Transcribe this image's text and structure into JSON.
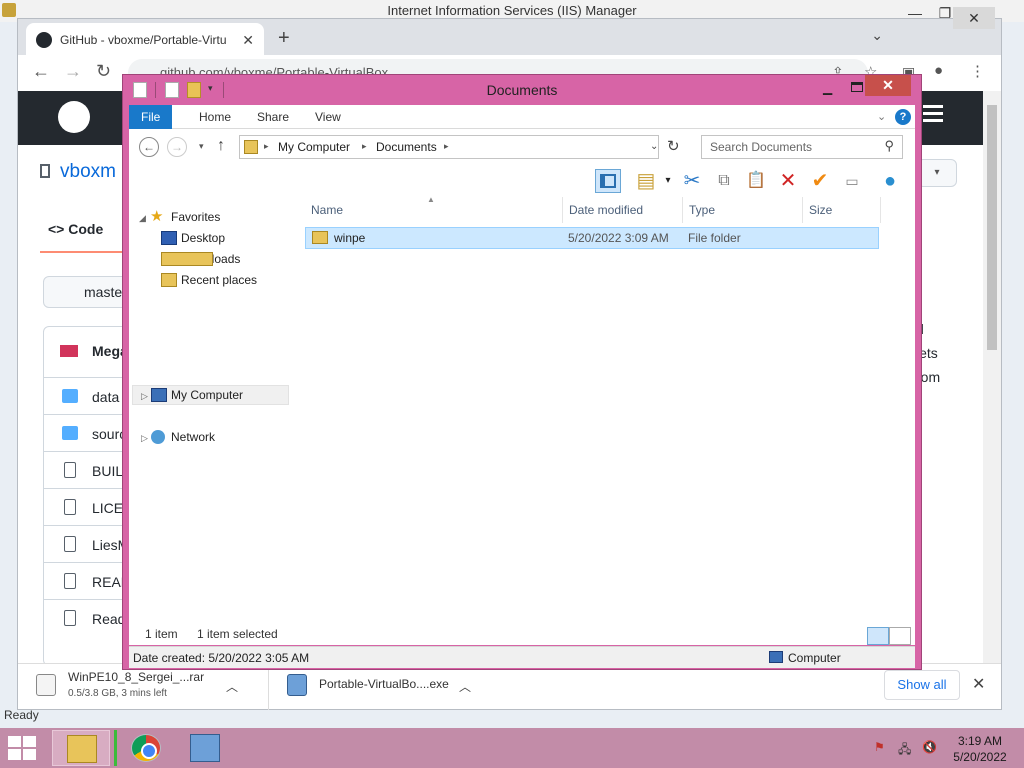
{
  "iis": {
    "title": "Internet Information Services (IIS) Manager"
  },
  "browser": {
    "tab_title": "GitHub - vboxme/Portable-Virtu",
    "url": "github.com/vboxme/Portable-VirtualBox",
    "page": {
      "repo_name": "vboxm",
      "code_tab": "Code",
      "branch": "maste",
      "commit_author": "Mega",
      "files": [
        "data",
        "sourc",
        "BUILD",
        "LICEN",
        "LiesM",
        "READ",
        "Read"
      ],
      "about_lines": [
        "d",
        "lets",
        "rom"
      ]
    },
    "downloads": [
      {
        "name": "WinPE10_8_Sergei_...rar",
        "status": "0.5/3.8 GB, 3 mins left"
      },
      {
        "name": "Portable-VirtualBo....exe",
        "status": ""
      }
    ],
    "show_all": "Show all",
    "status_text": "Ready"
  },
  "explorer": {
    "title": "Documents",
    "ribbon_tabs": [
      "File",
      "Home",
      "Share",
      "View"
    ],
    "help": "?",
    "breadcrumb": [
      "My Computer",
      "Documents"
    ],
    "search_placeholder": "Search Documents",
    "nav": {
      "favorites": "Favorites",
      "favorites_items": [
        "Desktop",
        "Downloads",
        "Recent places"
      ],
      "my_computer": "My Computer",
      "network": "Network"
    },
    "columns": [
      "Name",
      "Date modified",
      "Type",
      "Size"
    ],
    "rows": [
      {
        "name": "winpe",
        "date": "5/20/2022 3:09 AM",
        "type": "File folder",
        "size": ""
      }
    ],
    "status": {
      "count": "1 item",
      "selected": "1 item selected"
    },
    "details": {
      "date_created": "Date created: 5/20/2022 3:05 AM",
      "location": "Computer"
    }
  },
  "taskbar": {
    "time": "3:19 AM",
    "date": "5/20/2022"
  },
  "colors": {
    "window_frame": "#d764a6",
    "taskbar": "#c28ca8",
    "ribbon_file": "#1979ca",
    "selection": "#cce8ff"
  }
}
